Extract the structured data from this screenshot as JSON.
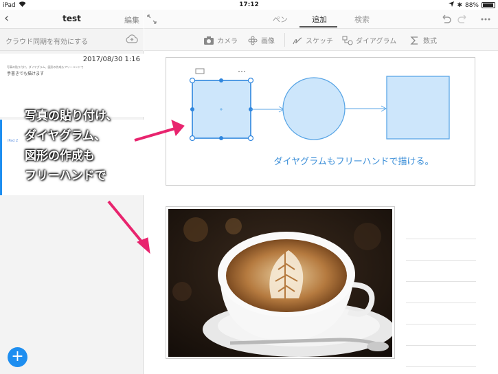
{
  "status": {
    "device": "iPad",
    "time": "17:12",
    "battery": "88%"
  },
  "sidebar": {
    "title": "test",
    "edit_label": "編集",
    "sync_label": "クラウド同期を有効にする",
    "note1": {
      "date": "2017/08/30 1:16",
      "text_line1": "写真の貼り付け、ダイヤグラム、図形の作成もフリーハンドで",
      "text_line2": "手書きでも描けます"
    },
    "note2": {
      "label": "iPad 2"
    }
  },
  "toolbar": {
    "tabs": [
      "ペン",
      "追加",
      "検索"
    ],
    "active_tab": "追加"
  },
  "tools": {
    "camera": "カメラ",
    "image": "画像",
    "sketch": "スケッチ",
    "diagram": "ダイアグラム",
    "math": "数式"
  },
  "canvas": {
    "caption": "ダイヤグラムもフリーハンドで描ける。"
  },
  "annotation": {
    "lines": [
      "写真の貼り付け、",
      "ダイヤグラム、",
      "図形の作成も",
      "フリーハンドで"
    ]
  },
  "colors": {
    "accent": "#1e8ef0",
    "shape_fill": "#cde6fb",
    "shape_stroke": "#5aa6e6",
    "annotation_arrow": "#e8246e"
  }
}
